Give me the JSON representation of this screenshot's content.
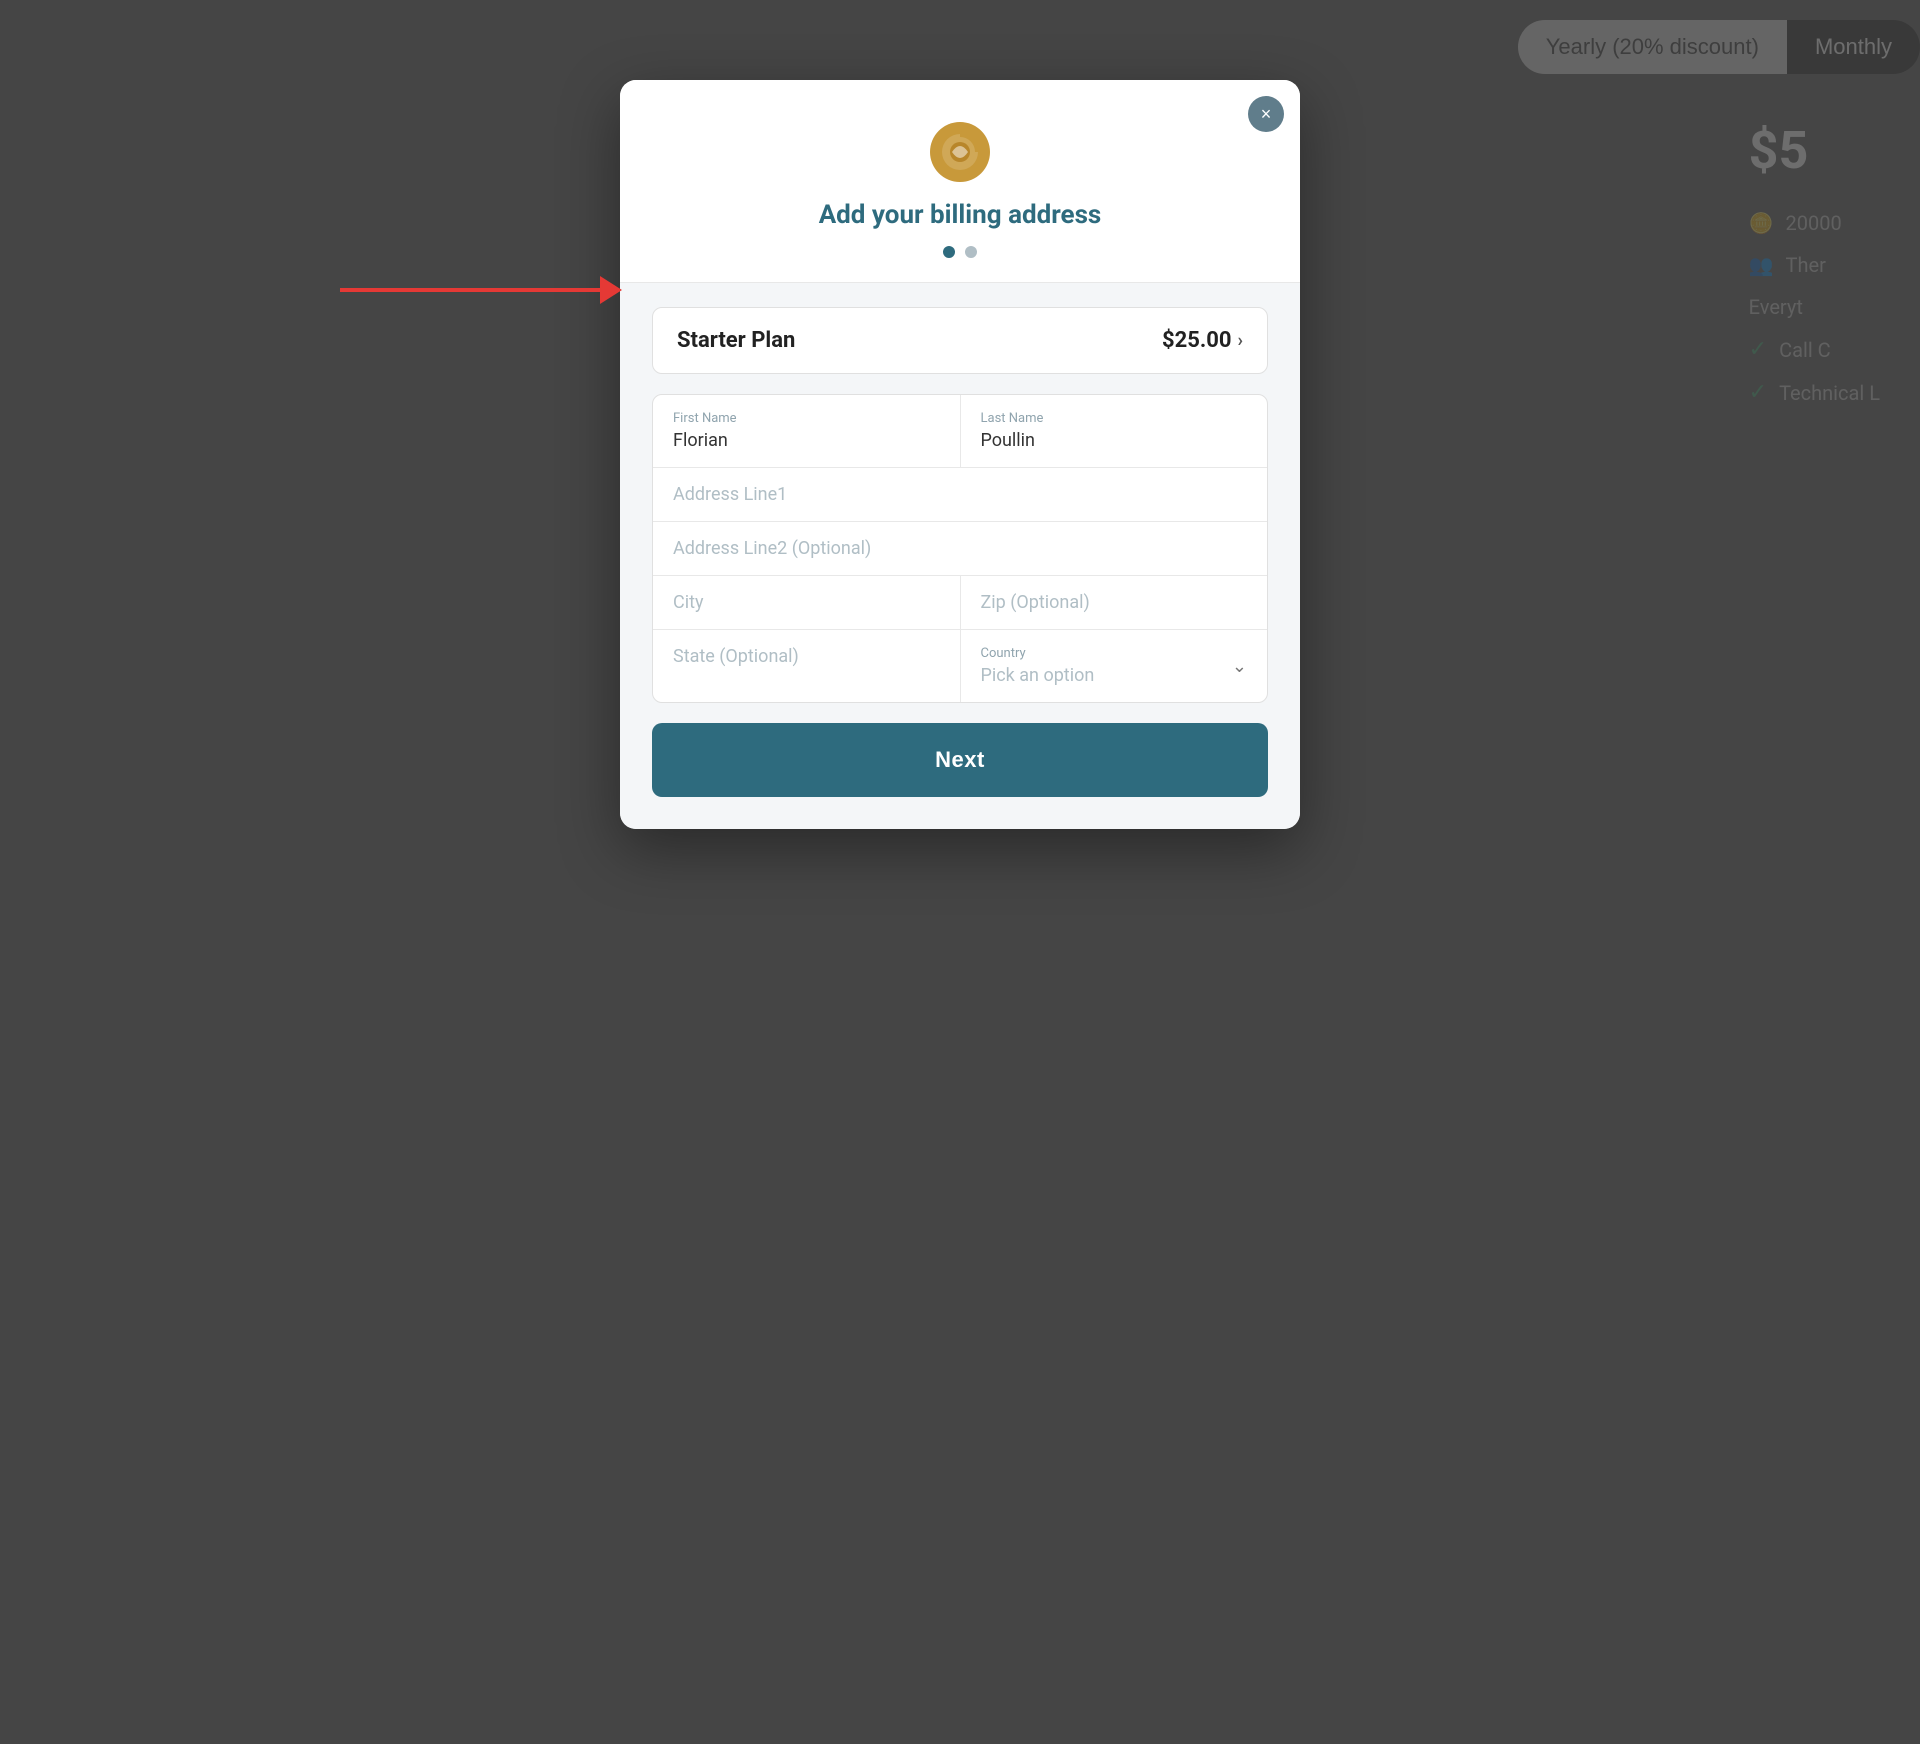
{
  "background": {
    "color": "#606060"
  },
  "topControls": {
    "yearly_label": "Yearly (20% discount)",
    "monthly_label": "Monthly"
  },
  "rightPanel": {
    "price": "$5",
    "credits": "20000",
    "members_text": "Ther",
    "feature1": "Everyt",
    "feature2": "Call C",
    "feature3": "Technical L"
  },
  "modal": {
    "logo_alt": "App logo",
    "title": "Add your billing address",
    "close_label": "×",
    "dots": [
      {
        "active": true
      },
      {
        "active": false
      }
    ],
    "plan": {
      "name": "Starter Plan",
      "price": "$25.00",
      "chevron": "›"
    },
    "form": {
      "first_name_label": "First Name",
      "first_name_value": "Florian",
      "last_name_label": "Last Name",
      "last_name_value": "Poullin",
      "address1_placeholder": "Address Line1",
      "address2_placeholder": "Address Line2 (Optional)",
      "city_placeholder": "City",
      "zip_placeholder": "Zip (Optional)",
      "state_placeholder": "State (Optional)",
      "country_label": "Country",
      "country_placeholder": "Pick an option"
    },
    "next_button": "Next"
  }
}
